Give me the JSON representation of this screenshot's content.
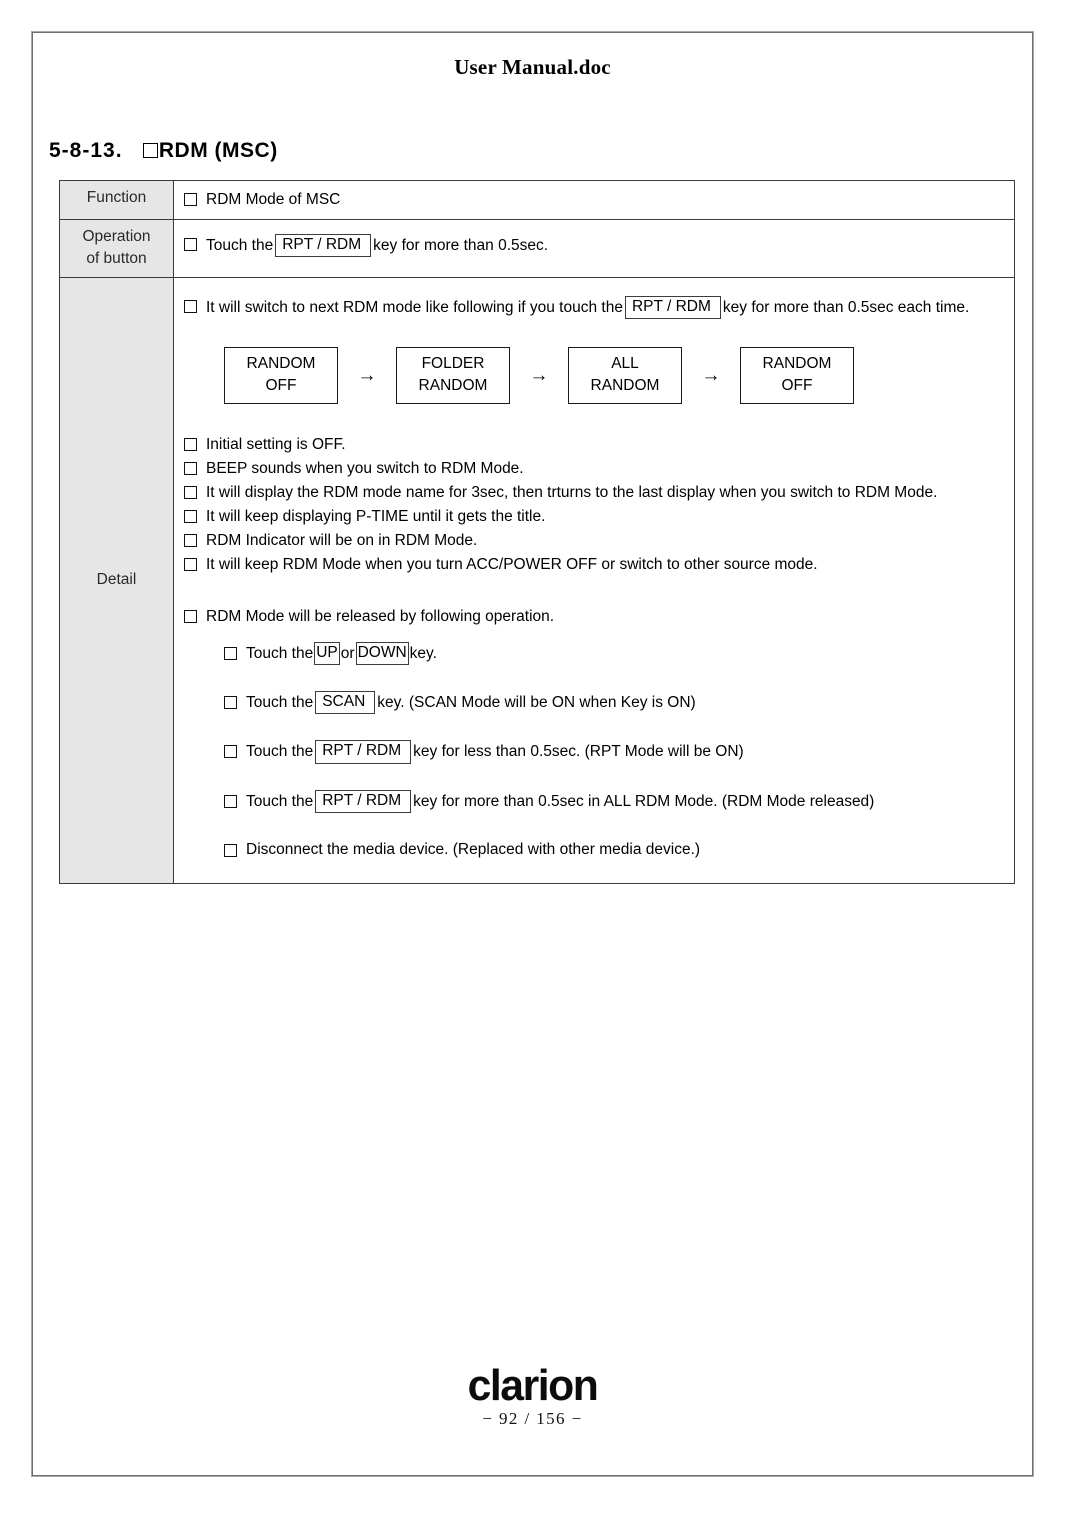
{
  "document": {
    "header_title": "User Manual.doc",
    "section_number": "5-8-13.",
    "section_title": "RDM (MSC)"
  },
  "table": {
    "rows": {
      "function": {
        "label": "Function",
        "items": [
          {
            "text": "RDM Mode of MSC"
          }
        ]
      },
      "operation": {
        "label_line1": "Operation",
        "label_line2": "of button",
        "item_pre": "Touch the",
        "item_key": "RPT / RDM",
        "item_post": "key for more than 0.5sec."
      },
      "detail": {
        "label": "Detail",
        "intro_pre": "It will switch to next RDM mode like following if you touch the",
        "intro_key": "RPT / RDM",
        "intro_post": "key for more than 0.5sec each time.",
        "flow": {
          "arrow": "→",
          "boxes": [
            {
              "line1": "RANDOM",
              "line2": "OFF"
            },
            {
              "line1": "FOLDER",
              "line2": "RANDOM"
            },
            {
              "line1": "ALL",
              "line2": "RANDOM"
            },
            {
              "line1": "RANDOM",
              "line2": "OFF"
            }
          ]
        },
        "notes": [
          "Initial setting is OFF.",
          "BEEP sounds when you switch to RDM Mode.",
          "It will display the RDM mode name for 3sec, then trturns to the last display when you switch to RDM Mode.",
          "It will keep displaying P-TIME until it gets the title.",
          "RDM Indicator will be on in RDM Mode.",
          "It will keep RDM Mode when you turn ACC/POWER OFF or switch to other source mode."
        ],
        "release_heading": "RDM Mode will be released by following operation.",
        "release_items": [
          {
            "pre": "Touch the",
            "key1": "UP",
            "mid": "or",
            "key2": "DOWN",
            "post": "key."
          },
          {
            "pre": "Touch the",
            "key1": "SCAN",
            "post": "key. (SCAN Mode will be ON when Key is ON)"
          },
          {
            "pre": "Touch the",
            "key1": "RPT / RDM",
            "post": "key for less than 0.5sec. (RPT Mode will be ON)"
          },
          {
            "pre": "Touch the",
            "key1": "RPT / RDM",
            "post": "key for more than 0.5sec in ALL RDM Mode. (RDM Mode released)"
          },
          {
            "post": "Disconnect the media device. (Replaced with other media device.)"
          }
        ]
      }
    }
  },
  "footer": {
    "brand": "clarion",
    "page_number": "− 92 / 156 −"
  }
}
